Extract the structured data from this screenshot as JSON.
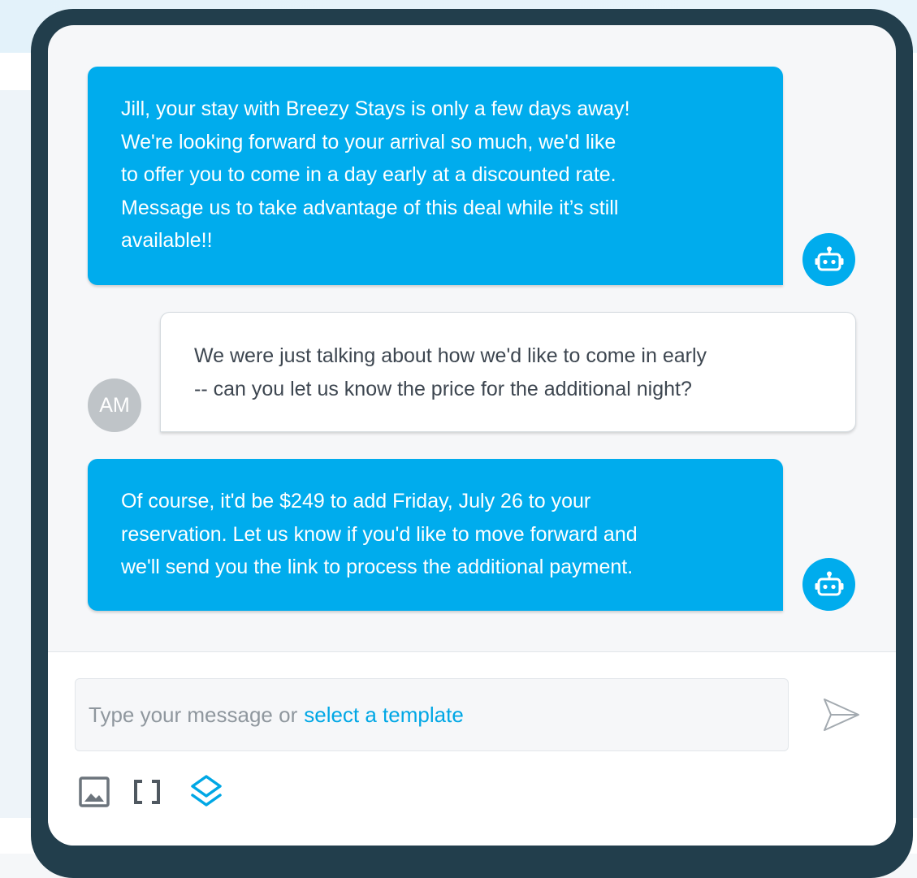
{
  "colors": {
    "frame": "#223e4c",
    "bot_bubble": "#00aced",
    "user_avatar": "#bfc4c8",
    "link": "#00a7e5"
  },
  "messages": [
    {
      "sender": "bot",
      "avatar_icon": "robot-icon",
      "lines": [
        "Jill, your stay with Breezy Stays is only a few days away!",
        "We're looking forward to your arrival so much, we'd like",
        "to offer you to come in a day early at a discounted rate.",
        "Message us to take advantage of this deal while it’s still",
        "available!!"
      ]
    },
    {
      "sender": "user",
      "avatar_initials": "AM",
      "lines": [
        "We were just talking about how we'd like to come in early",
        "-- can you let us know the price for the additional night?"
      ]
    },
    {
      "sender": "bot",
      "avatar_icon": "robot-icon",
      "lines": [
        "Of course, it'd be $249 to add Friday, July 26 to your",
        "reservation. Let us know if you'd like to move forward and",
        "we'll send you the link to process the additional payment."
      ]
    }
  ],
  "composer": {
    "placeholder": "Type your message or",
    "template_link": "select a template",
    "send_icon": "send-icon",
    "tools": [
      "image-icon",
      "brackets-icon",
      "layers-icon"
    ]
  }
}
